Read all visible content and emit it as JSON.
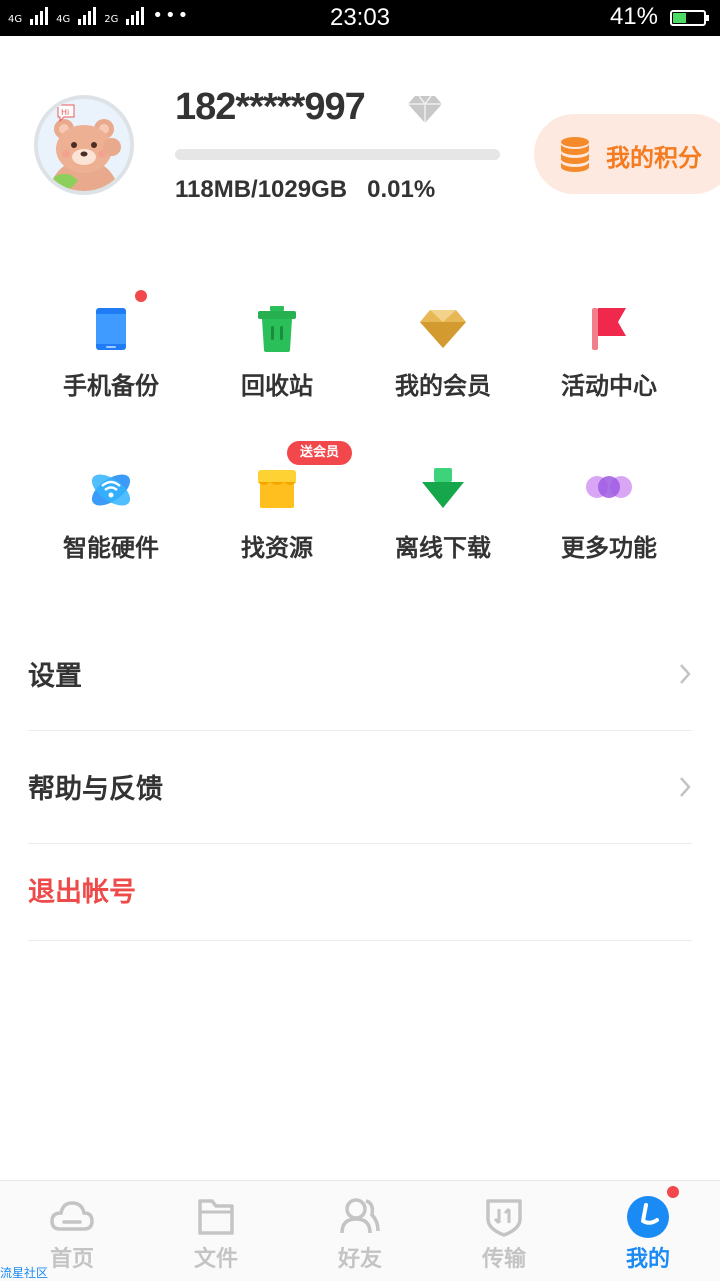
{
  "status_bar": {
    "network_left": "4G",
    "network_mid": "4G",
    "network_right": "2G",
    "more": "•••",
    "time": "23:03",
    "battery_percent": "41%",
    "battery_level": 0.41
  },
  "profile": {
    "username": "182*****997",
    "quota_text": "118MB/1029GB",
    "quota_percent_text": "0.01%",
    "quota_fraction": 0.0001,
    "points_button": "我的积分"
  },
  "grid": [
    {
      "label": "手机备份",
      "icon": "phone-icon",
      "dot": true
    },
    {
      "label": "回收站",
      "icon": "trash-icon",
      "dot": false
    },
    {
      "label": "我的会员",
      "icon": "diamond-icon",
      "dot": false
    },
    {
      "label": "活动中心",
      "icon": "flag-icon",
      "dot": false
    },
    {
      "label": "智能硬件",
      "icon": "smart-hardware-icon",
      "dot": false
    },
    {
      "label": "找资源",
      "icon": "shop-icon",
      "badge": "送会员"
    },
    {
      "label": "离线下载",
      "icon": "download-arrow-icon",
      "dot": false
    },
    {
      "label": "更多功能",
      "icon": "more-dots-icon",
      "dot": false
    }
  ],
  "menu": {
    "settings": "设置",
    "help": "帮助与反馈",
    "logout": "退出帐号"
  },
  "tabs": [
    {
      "label": "首页",
      "icon": "cloud-icon",
      "active": false
    },
    {
      "label": "文件",
      "icon": "folder-icon",
      "active": false
    },
    {
      "label": "好友",
      "icon": "friends-icon",
      "active": false
    },
    {
      "label": "传输",
      "icon": "transfer-icon",
      "active": false
    },
    {
      "label": "我的",
      "icon": "profile-icon",
      "active": true
    }
  ],
  "watermark": "流星社区",
  "colors": {
    "accent_blue": "#1a8af5",
    "orange": "#f47b20",
    "red": "#ef4a4a"
  }
}
